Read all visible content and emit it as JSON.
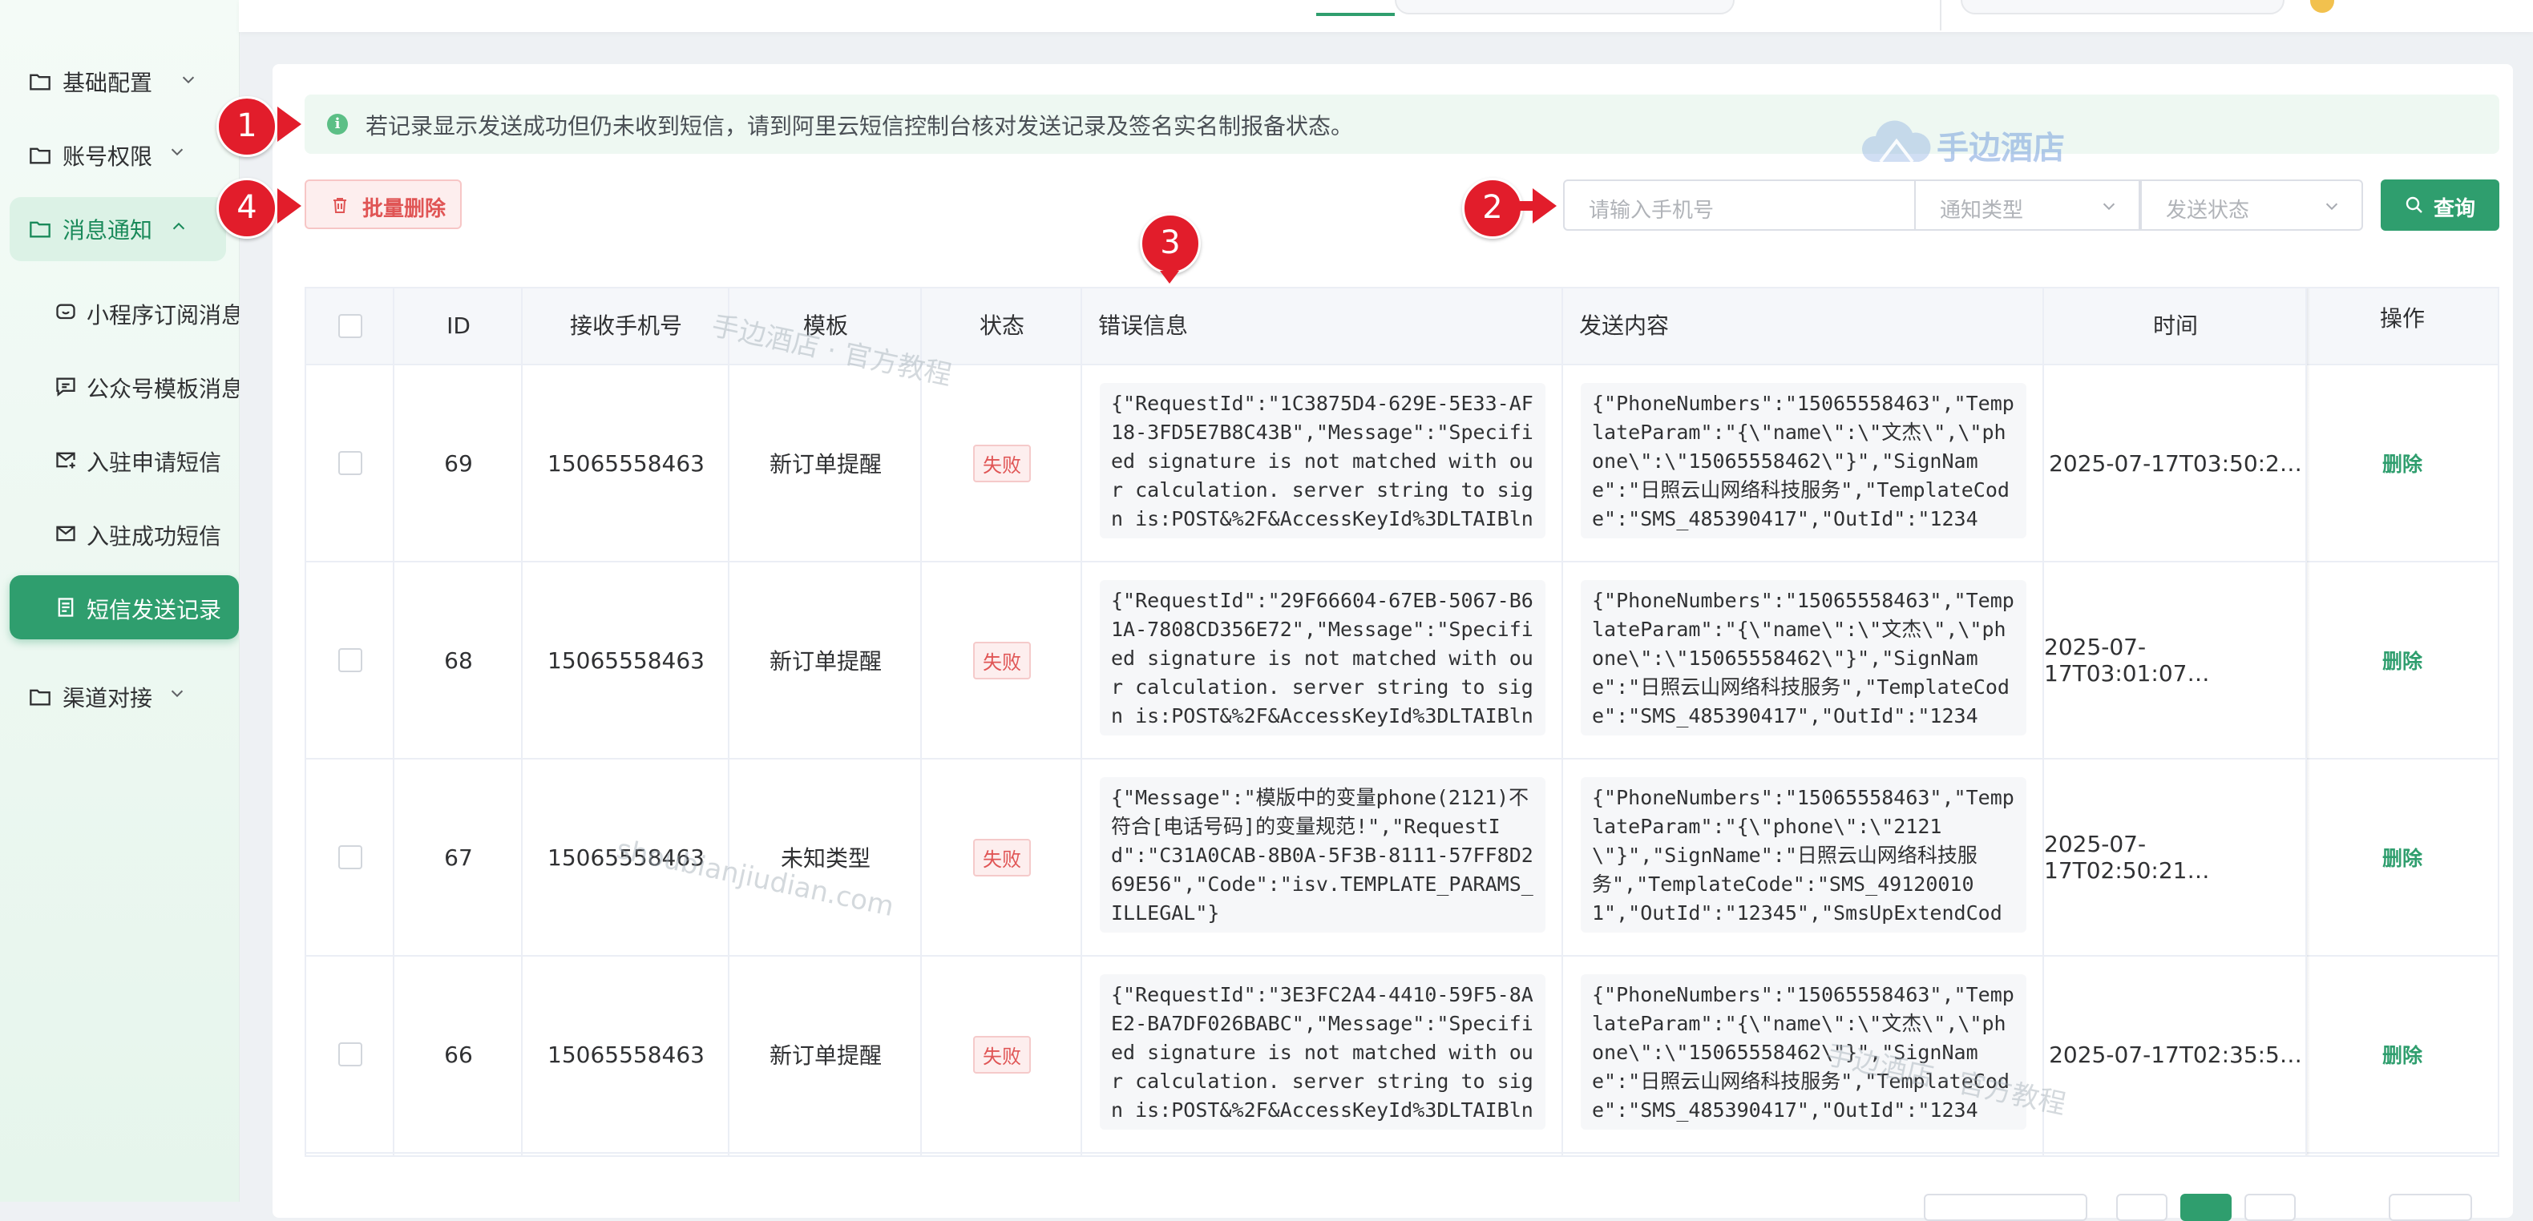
{
  "sidebar": {
    "items": [
      {
        "label": "基础配置",
        "icon": "folder-icon",
        "expanded": false
      },
      {
        "label": "账号权限",
        "icon": "folder-icon",
        "expanded": false
      },
      {
        "label": "消息通知",
        "icon": "folder-icon",
        "expanded": true
      },
      {
        "label": "渠道对接",
        "icon": "folder-icon",
        "expanded": false
      }
    ],
    "subitems": [
      {
        "label": "小程序订阅消息",
        "icon": "message-icon"
      },
      {
        "label": "公众号模板消息",
        "icon": "chat-icon"
      },
      {
        "label": "入驻申请短信",
        "icon": "mail-add-icon"
      },
      {
        "label": "入驻成功短信",
        "icon": "mail-icon"
      },
      {
        "label": "短信发送记录",
        "icon": "document-icon",
        "active": true
      }
    ]
  },
  "alert": {
    "text": "若记录显示发送成功但仍未收到短信，请到阿里云短信控制台核对发送记录及签名实名制报备状态。"
  },
  "toolbar": {
    "batch_delete": "批量删除",
    "phone_placeholder": "请输入手机号",
    "type_placeholder": "通知类型",
    "status_placeholder": "发送状态",
    "query": "查询"
  },
  "annotations": [
    "1",
    "2",
    "3",
    "4"
  ],
  "table": {
    "headers": [
      "ID",
      "接收手机号",
      "模板",
      "状态",
      "错误信息",
      "发送内容",
      "时间",
      "操作"
    ],
    "rows": [
      {
        "id": "69",
        "phone": "15065558463",
        "template": "新订单提醒",
        "status": "失败",
        "error": "{\"RequestId\":\"1C3875D4-629E-5E33-AF18-3FD5E7B8C43B\",\"Message\":\"Specified signature is not matched with our calculation. server string to sign is:POST&%2F&AccessKeyId%3DLTAIBln",
        "content": "{\"PhoneNumbers\":\"15065558463\",\"TemplateParam\":\"{\\\"name\\\":\\\"文杰\\\",\\\"phone\\\":\\\"15065558462\\\"}\",\"SignName\":\"日照云山网络科技服务\",\"TemplateCode\":\"SMS_485390417\",\"OutId\":\"1234",
        "time": "2025-07-17T03:50:2…",
        "action": "删除"
      },
      {
        "id": "68",
        "phone": "15065558463",
        "template": "新订单提醒",
        "status": "失败",
        "error": "{\"RequestId\":\"29F66604-67EB-5067-B61A-7808CD356E72\",\"Message\":\"Specified signature is not matched with our calculation. server string to sign is:POST&%2F&AccessKeyId%3DLTAIBln",
        "content": "{\"PhoneNumbers\":\"15065558463\",\"TemplateParam\":\"{\\\"name\\\":\\\"文杰\\\",\\\"phone\\\":\\\"15065558462\\\"}\",\"SignName\":\"日照云山网络科技服务\",\"TemplateCode\":\"SMS_485390417\",\"OutId\":\"1234",
        "time": "2025-07-17T03:01:07…",
        "action": "删除"
      },
      {
        "id": "67",
        "phone": "15065558463",
        "template": "未知类型",
        "status": "失败",
        "error": "{\"Message\":\"模版中的变量phone(2121)不符合[电话号码]的变量规范!\",\"RequestId\":\"C31A0CAB-8B0A-5F3B-8111-57FF8D269E56\",\"Code\":\"isv.TEMPLATE_PARAMS_ILLEGAL\"}",
        "content": "{\"PhoneNumbers\":\"15065558463\",\"TemplateParam\":\"{\\\"phone\\\":\\\"2121\\\"}\",\"SignName\":\"日照云山网络科技服务\",\"TemplateCode\":\"SMS_491200101\",\"OutId\":\"12345\",\"SmsUpExtendCod",
        "time": "2025-07-17T02:50:21…",
        "action": "删除"
      },
      {
        "id": "66",
        "phone": "15065558463",
        "template": "新订单提醒",
        "status": "失败",
        "error": "{\"RequestId\":\"3E3FC2A4-4410-59F5-8AE2-BA7DF026BABC\",\"Message\":\"Specified signature is not matched with our calculation. server string to sign is:POST&%2F&AccessKeyId%3DLTAIBln",
        "content": "{\"PhoneNumbers\":\"15065558463\",\"TemplateParam\":\"{\\\"name\\\":\\\"文杰\\\",\\\"phone\\\":\\\"15065558462\\\"}\",\"SignName\":\"日照云山网络科技服务\",\"TemplateCode\":\"SMS_485390417\",\"OutId\":\"1234",
        "time": "2025-07-17T02:35:5…",
        "action": "删除"
      }
    ]
  },
  "watermarks": {
    "logo": "手边酒店",
    "line1": "手边酒店 · 官方教程",
    "line2": "shoubianjiudian.com",
    "line3": "手边酒店 · 官方教程"
  },
  "colors": {
    "primary": "#2f9e6e",
    "danger": "#e05555",
    "annotation": "#e21d2b"
  }
}
